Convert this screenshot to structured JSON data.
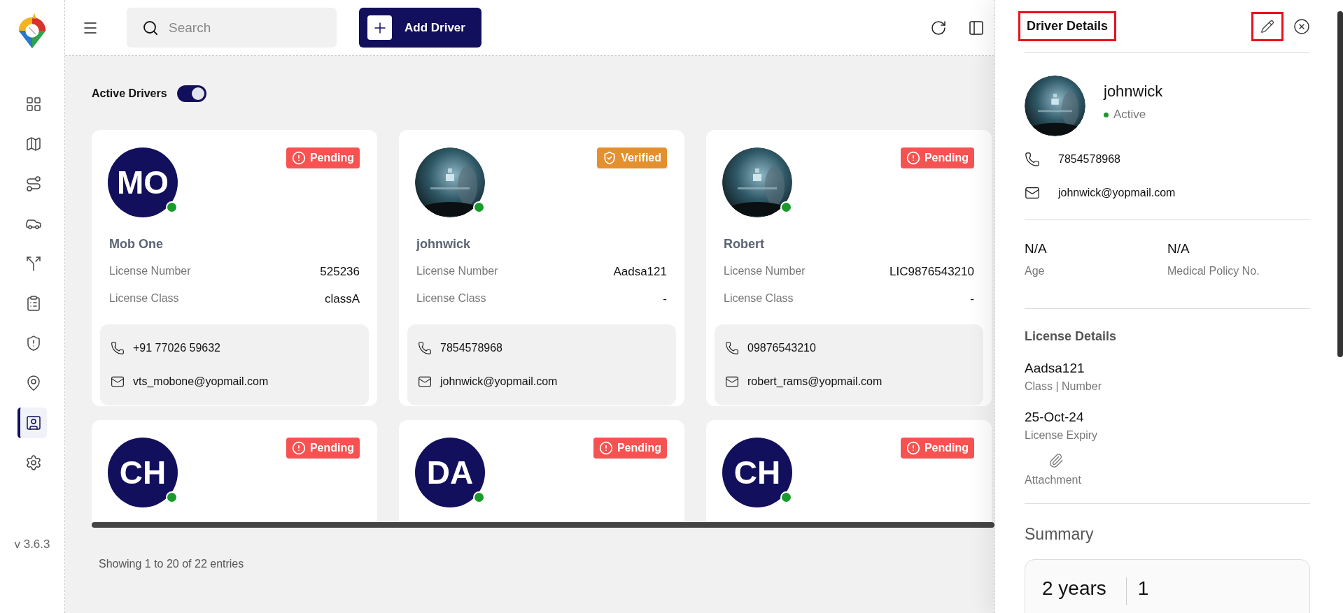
{
  "sidebar": {
    "items": [
      {
        "selected": false
      },
      {
        "selected": false
      },
      {
        "selected": false
      },
      {
        "selected": false
      },
      {
        "selected": false
      },
      {
        "selected": false
      },
      {
        "selected": false
      },
      {
        "selected": false
      },
      {
        "selected": true
      },
      {
        "selected": false
      }
    ],
    "version": "v 3.6.3"
  },
  "header": {
    "search_placeholder": "Search",
    "add_button": "Add Driver"
  },
  "filter": {
    "label": "Active Drivers",
    "on": true
  },
  "drivers": [
    {
      "kind": "initials",
      "initials": "MO",
      "online": true,
      "name": "Mob One",
      "status": {
        "kind": "pending",
        "label": "Pending"
      },
      "fields": [
        {
          "label": "License Number",
          "value": "525236"
        },
        {
          "label": "License Class",
          "value": "classA"
        }
      ],
      "phone": "+91 77026 59632",
      "email": "vts_mobone@yopmail.com"
    },
    {
      "kind": "picture",
      "online": true,
      "name": "johnwick",
      "status": {
        "kind": "verified",
        "label": "Verified"
      },
      "fields": [
        {
          "label": "License Number",
          "value": "Aadsa121"
        },
        {
          "label": "License Class",
          "value": "-"
        }
      ],
      "phone": "7854578968",
      "email": "johnwick@yopmail.com"
    },
    {
      "kind": "picture",
      "online": true,
      "name": "Robert",
      "status": {
        "kind": "pending",
        "label": "Pending"
      },
      "fields": [
        {
          "label": "License Number",
          "value": "LIC9876543210"
        },
        {
          "label": "License Class",
          "value": "-"
        }
      ],
      "phone": "09876543210",
      "email": "robert_rams@yopmail.com"
    },
    {
      "kind": "initials",
      "initials": "CH",
      "online": true,
      "status": {
        "kind": "pending",
        "label": "Pending"
      }
    },
    {
      "kind": "initials",
      "initials": "DA",
      "online": true,
      "status": {
        "kind": "pending",
        "label": "Pending"
      }
    },
    {
      "kind": "initials",
      "initials": "CH",
      "online": true,
      "status": {
        "kind": "pending",
        "label": "Pending"
      }
    }
  ],
  "footer": "Showing 1 to 20 of 22 entries",
  "details": {
    "title": {
      "text": "Driver Details",
      "highlighted": true
    },
    "edit_button": {
      "highlighted": true
    },
    "profile": {
      "name": "johnwick",
      "status": "Active",
      "phone": "7854578968",
      "email": "johnwick@yopmail.com"
    },
    "info": [
      {
        "value": "N/A",
        "label": "Age"
      },
      {
        "value": "N/A",
        "label": "Medical Policy No."
      }
    ],
    "license": {
      "heading": "License Details",
      "items": [
        {
          "value": "Aadsa121",
          "label": "Class | Number"
        },
        {
          "value": "25-Oct-24",
          "label": "License Expiry"
        }
      ],
      "attachment": "Attachment"
    },
    "summary": {
      "heading": "Summary",
      "stats": [
        "2 years",
        "1"
      ]
    }
  }
}
